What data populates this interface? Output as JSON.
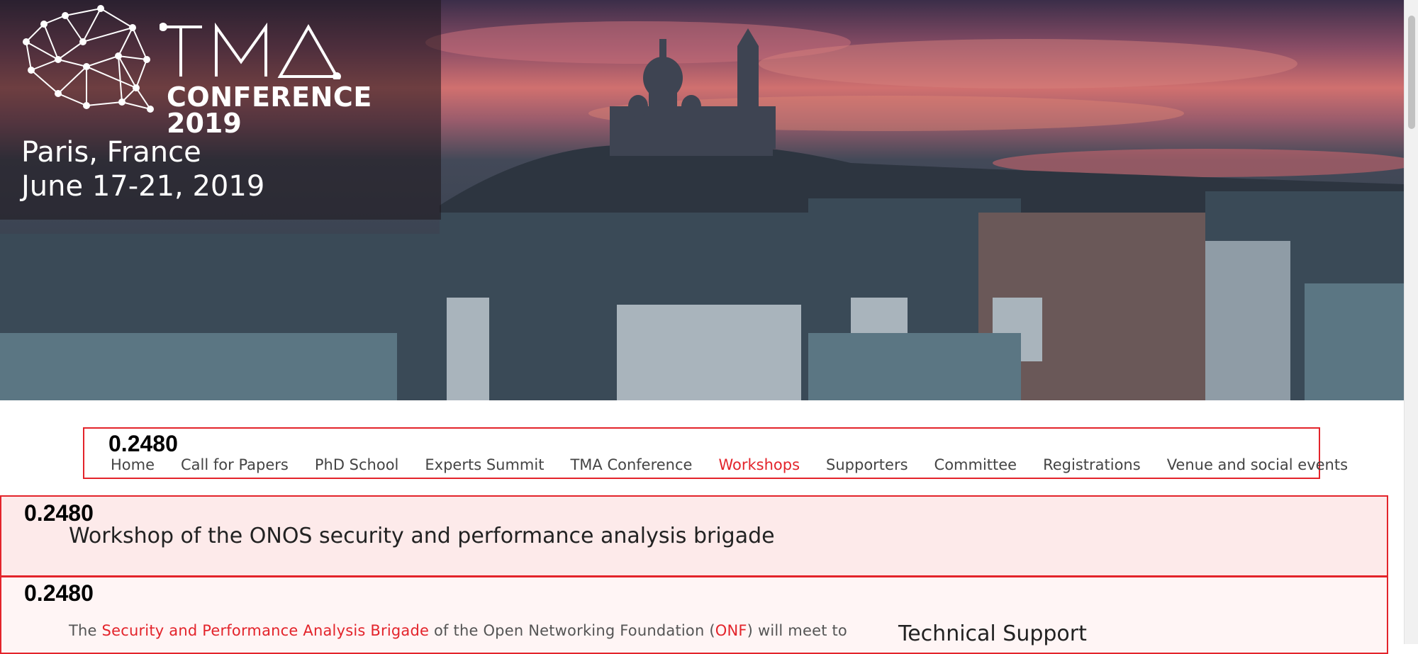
{
  "hero": {
    "logo_word": "CONFERENCE",
    "logo_year": "2019",
    "city": "Paris, France",
    "dates": "June 17-21, 2019"
  },
  "scores": {
    "nav": "0.2480",
    "title": "0.2480",
    "content": "0.2480"
  },
  "nav": {
    "items": [
      {
        "label": "Home",
        "active": false
      },
      {
        "label": "Call for Papers",
        "active": false
      },
      {
        "label": "PhD School",
        "active": false
      },
      {
        "label": "Experts Summit",
        "active": false
      },
      {
        "label": "TMA Conference",
        "active": false
      },
      {
        "label": "Workshops",
        "active": true
      },
      {
        "label": "Supporters",
        "active": false
      },
      {
        "label": "Committee",
        "active": false
      },
      {
        "label": "Registrations",
        "active": false
      },
      {
        "label": "Venue and social events",
        "active": false
      }
    ],
    "active_color": "#e3242b"
  },
  "page": {
    "title": "Workshop of the ONOS security and performance analysis brigade"
  },
  "content": {
    "p1_before": "The ",
    "p1_link1": "Security and Performance Analysis Brigade",
    "p1_middle": " of the Open Networking Foundation (",
    "p1_link2": "ONF",
    "p1_after": ") will meet to"
  },
  "sidebar": {
    "heading": "Technical Support"
  },
  "icons": {
    "logo": "brain-network-logo",
    "logo_letters": "tma-letters-logo"
  },
  "colors": {
    "accent": "#e3242b",
    "title_band": "#fdeaea"
  }
}
